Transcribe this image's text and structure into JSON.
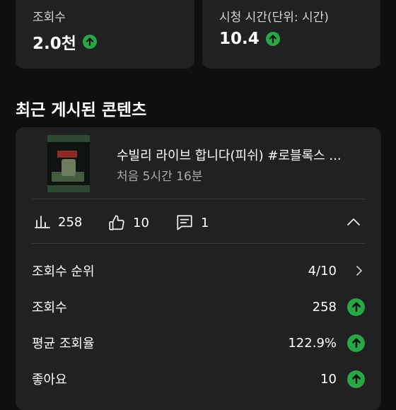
{
  "stats": {
    "views_label": "조회수",
    "views_value": "2.0천",
    "watch_label": "시청 시간(단위: 시간)",
    "watch_value": "10.4"
  },
  "section_title": "최근 게시된 콘텐츠",
  "video": {
    "title": "수빌리 라이브 합니다(피쉬) #로블록스 ...",
    "subtitle": "처음 5시간 16분",
    "views": "258",
    "likes": "10",
    "comments": "1"
  },
  "rows": [
    {
      "label": "조회수 순위",
      "value": "4/10",
      "icon": "chevron-right-icon"
    },
    {
      "label": "조회수",
      "value": "258",
      "icon": "arrow-up-icon"
    },
    {
      "label": "평균 조회율",
      "value": "122.9%",
      "icon": "arrow-up-icon"
    },
    {
      "label": "좋아요",
      "value": "10",
      "icon": "arrow-up-icon"
    }
  ],
  "colors": {
    "background": "#0f0f0f",
    "card": "#212121",
    "up_green": "#27a745"
  }
}
